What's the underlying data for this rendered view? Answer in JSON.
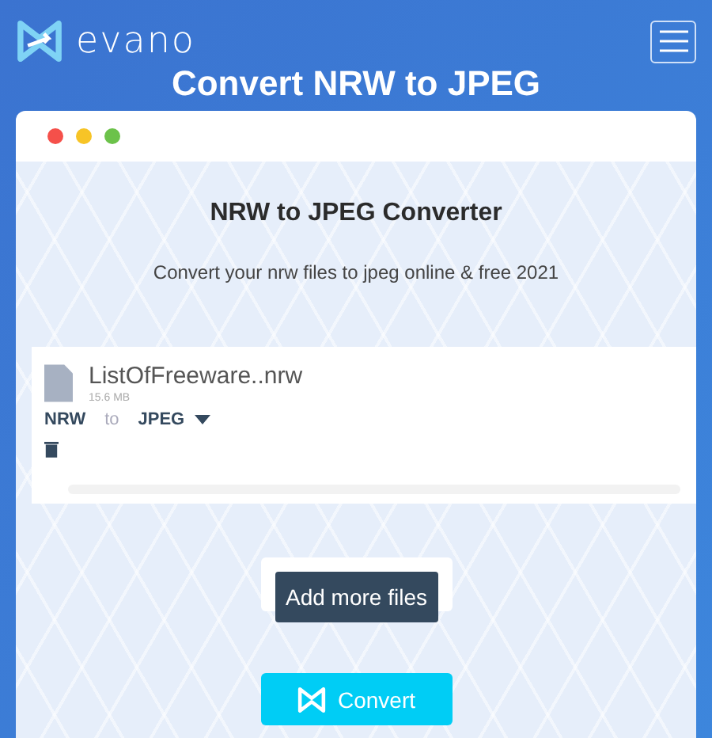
{
  "header": {
    "logo_text": "evano"
  },
  "page_title": "Convert NRW to JPEG",
  "converter": {
    "heading": "NRW to JPEG Converter",
    "subtitle": "Convert your nrw files to jpeg online & free 2021",
    "window_dots": [
      {
        "color": "#f5504a"
      },
      {
        "color": "#f7c426"
      },
      {
        "color": "#6cc24a"
      }
    ],
    "files": [
      {
        "name": "ListOfFreeware..nrw",
        "size": "15.6 MB",
        "from": "NRW",
        "to_word": "to",
        "to": "JPEG",
        "level": 0
      }
    ],
    "add_more": "Add more files",
    "convert": "Convert"
  }
}
